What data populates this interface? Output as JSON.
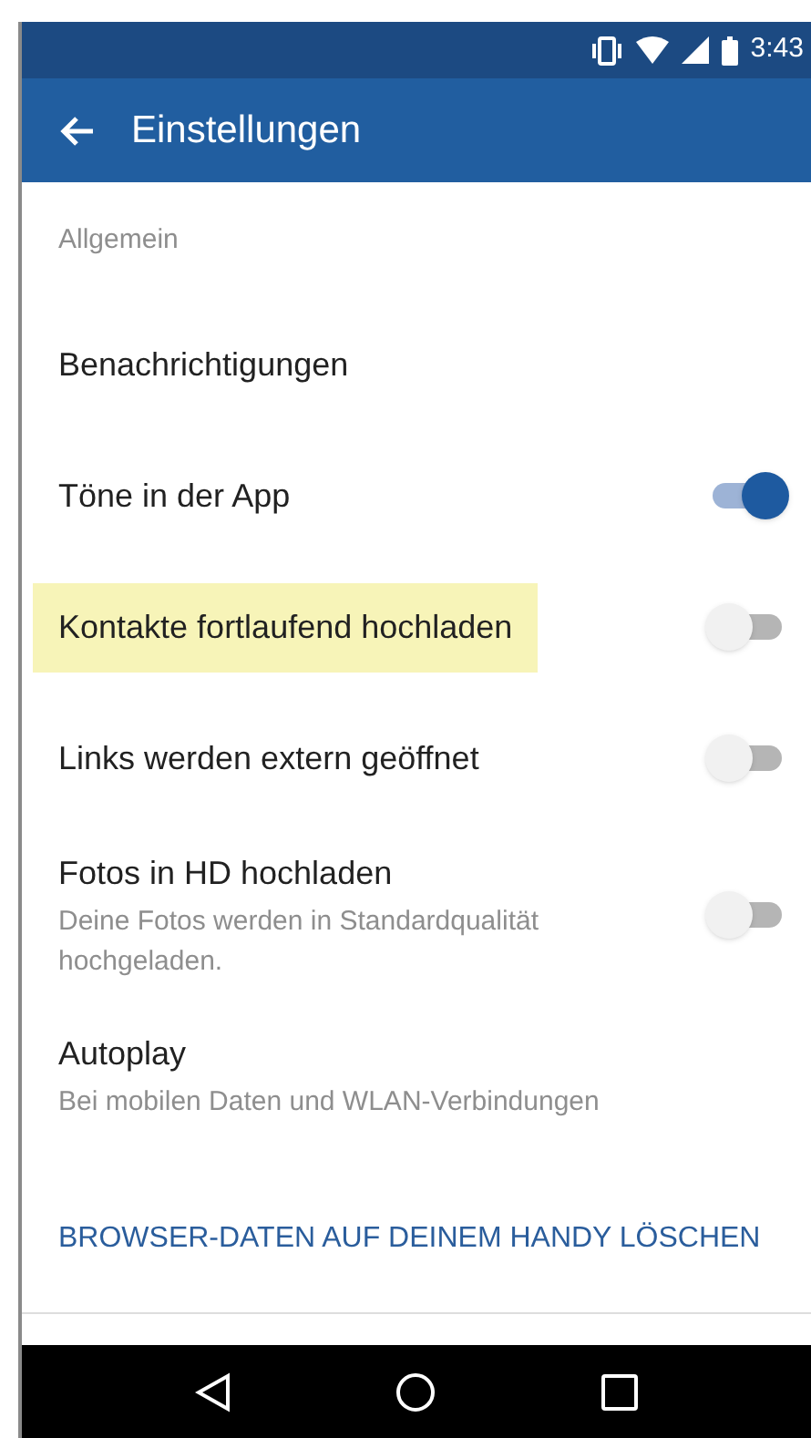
{
  "status_bar": {
    "time": "3:43"
  },
  "app_bar": {
    "title": "Einstellungen"
  },
  "section": {
    "title": "Allgemein"
  },
  "settings": [
    {
      "kind": "plain",
      "label": "Benachrichtigungen",
      "highlighted": false
    },
    {
      "kind": "toggle",
      "label": "Töne in der App",
      "on": true,
      "highlighted": false
    },
    {
      "kind": "toggle",
      "label": "Kontakte fortlaufend hochladen",
      "on": false,
      "highlighted": true
    },
    {
      "kind": "toggle",
      "label": "Links werden extern geöffnet",
      "on": false,
      "highlighted": false
    },
    {
      "kind": "toggle",
      "label": "Fotos in HD hochladen",
      "description": "Deine Fotos werden in Standardqualität hochgeladen.",
      "on": false,
      "highlighted": false
    },
    {
      "kind": "plain",
      "label": "Autoplay",
      "description": "Bei mobilen Daten und WLAN-Verbindungen",
      "highlighted": false
    }
  ],
  "action_link": "BROWSER-DATEN AUF DEINEM HANDY LÖSCHEN"
}
